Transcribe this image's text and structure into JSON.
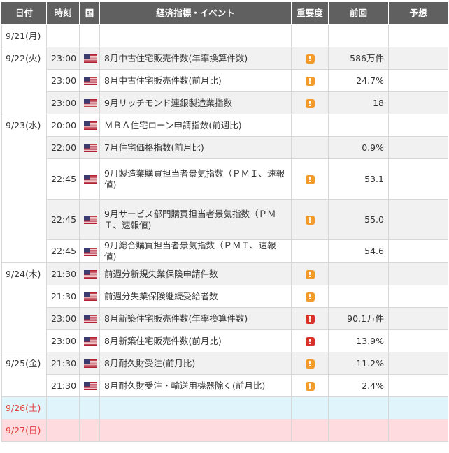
{
  "headers": {
    "date": "日付",
    "time": "時刻",
    "country": "国",
    "event": "経済指標・イベント",
    "importance": "重要度",
    "previous": "前回",
    "forecast": "予想"
  },
  "flag_icon": "us-flag-icon",
  "importance_colors": {
    "medium": "#f29b2b",
    "high": "#d9302a"
  },
  "rows": [
    {
      "date": "9/21(月)",
      "time": "",
      "event": "",
      "importance": "",
      "previous": "",
      "forecast": ""
    },
    {
      "date": "9/22(火)",
      "time": "23:00",
      "event": "8月中古住宅販売件数(年率換算件数)",
      "importance": "medium",
      "previous": "586万件",
      "forecast": ""
    },
    {
      "date": "",
      "time": "23:00",
      "event": "8月中古住宅販売件数(前月比)",
      "importance": "medium",
      "previous": "24.7%",
      "forecast": ""
    },
    {
      "date": "",
      "time": "23:00",
      "event": "9月リッチモンド連銀製造業指数",
      "importance": "medium",
      "previous": "18",
      "forecast": ""
    },
    {
      "date": "9/23(水)",
      "time": "20:00",
      "event": "ＭＢＡ住宅ローン申請指数(前週比)",
      "importance": "",
      "previous": "",
      "forecast": ""
    },
    {
      "date": "",
      "time": "22:00",
      "event": "7月住宅価格指数(前月比)",
      "importance": "",
      "previous": "0.9%",
      "forecast": ""
    },
    {
      "date": "",
      "time": "22:45",
      "event": "9月製造業購買担当者景気指数（ＰＭＩ、速報値)",
      "importance": "medium",
      "previous": "53.1",
      "forecast": ""
    },
    {
      "date": "",
      "time": "22:45",
      "event": "9月サービス部門購買担当者景気指数（ＰＭＩ、速報値)",
      "importance": "medium",
      "previous": "55.0",
      "forecast": ""
    },
    {
      "date": "",
      "time": "22:45",
      "event": "9月総合購買担当者景気指数（ＰＭＩ、速報値)",
      "importance": "",
      "previous": "54.6",
      "forecast": ""
    },
    {
      "date": "9/24(木)",
      "time": "21:30",
      "event": "前週分新規失業保険申請件数",
      "importance": "medium",
      "previous": "",
      "forecast": ""
    },
    {
      "date": "",
      "time": "21:30",
      "event": "前週分失業保険継続受給者数",
      "importance": "medium",
      "previous": "",
      "forecast": ""
    },
    {
      "date": "",
      "time": "23:00",
      "event": "8月新築住宅販売件数(年率換算件数)",
      "importance": "high",
      "previous": "90.1万件",
      "forecast": ""
    },
    {
      "date": "",
      "time": "23:00",
      "event": "8月新築住宅販売件数(前月比)",
      "importance": "high",
      "previous": "13.9%",
      "forecast": ""
    },
    {
      "date": "9/25(金)",
      "time": "21:30",
      "event": "8月耐久財受注(前月比)",
      "importance": "medium",
      "previous": "11.2%",
      "forecast": ""
    },
    {
      "date": "",
      "time": "21:30",
      "event": "8月耐久財受注・輸送用機器除く(前月比)",
      "importance": "medium",
      "previous": "2.4%",
      "forecast": ""
    },
    {
      "date": "9/26(土)",
      "time": "",
      "event": "",
      "importance": "",
      "previous": "",
      "forecast": ""
    },
    {
      "date": "9/27(日)",
      "time": "",
      "event": "",
      "importance": "",
      "previous": "",
      "forecast": ""
    }
  ]
}
